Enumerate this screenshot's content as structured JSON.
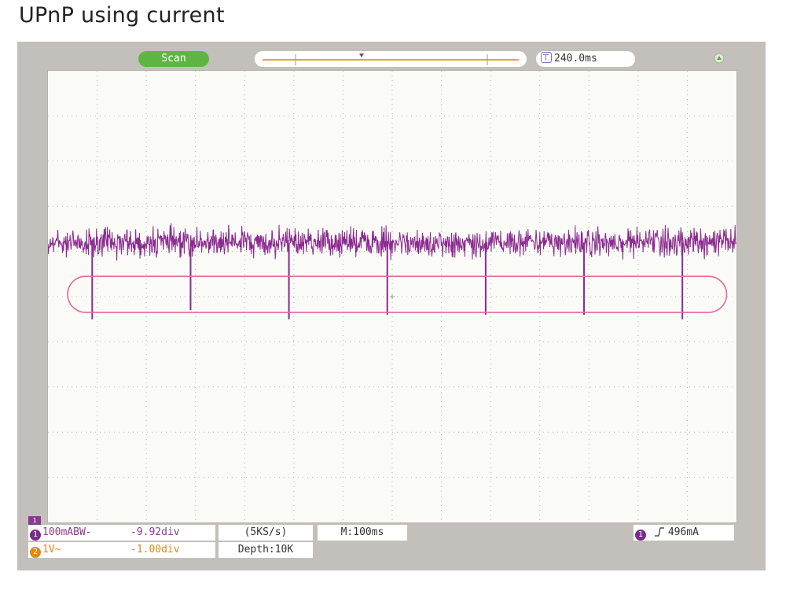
{
  "page_title": "UPnP using current",
  "scope": {
    "mode": "Scan",
    "timebase": "240.0ms",
    "ch1_marker": "1",
    "ch1_setting": "100mABW-",
    "ch1_offset": "-9.92div",
    "ch2_setting": "1V~",
    "ch2_offset": "-1.00div",
    "sample_rate": "(5KS/s)",
    "depth": "Depth:10K",
    "memory_time": "M:100ms",
    "trigger_level": "496mA",
    "colors": {
      "trace": "#8b2a90",
      "highlight": "#e36ba0",
      "mode_badge": "#5fb543",
      "timeline": "#e8a43a",
      "ch1": "#8b3a8f",
      "ch2": "#e08a12"
    },
    "icons": [
      "timebase-icon",
      "usb-icon",
      "trigger-rising-edge-icon"
    ]
  },
  "chart_data": {
    "type": "line",
    "title": "UPnP using current",
    "xlabel": "",
    "ylabel": "",
    "x_divisions": 14,
    "y_divisions": 10,
    "x_range_div": [
      0,
      14
    ],
    "y_range_div": [
      -5,
      5
    ],
    "grid": true,
    "series": [
      {
        "baseline_div": 1.2,
        "noise_amplitude_div": 0.45,
        "spikes": [
          {
            "x_div": 0.9,
            "depth_div": -0.5
          },
          {
            "x_div": 2.9,
            "depth_div": -0.3
          },
          {
            "x_div": 4.9,
            "depth_div": -0.5
          },
          {
            "x_div": 6.9,
            "depth_div": -0.4
          },
          {
            "x_div": 8.9,
            "depth_div": -0.4
          },
          {
            "x_div": 10.9,
            "depth_div": -0.4
          },
          {
            "x_div": 12.9,
            "depth_div": -0.5
          }
        ]
      }
    ],
    "highlight": {
      "x_range_div": [
        0.4,
        13.8
      ],
      "y_range_div": [
        -0.35,
        0.45
      ]
    }
  }
}
